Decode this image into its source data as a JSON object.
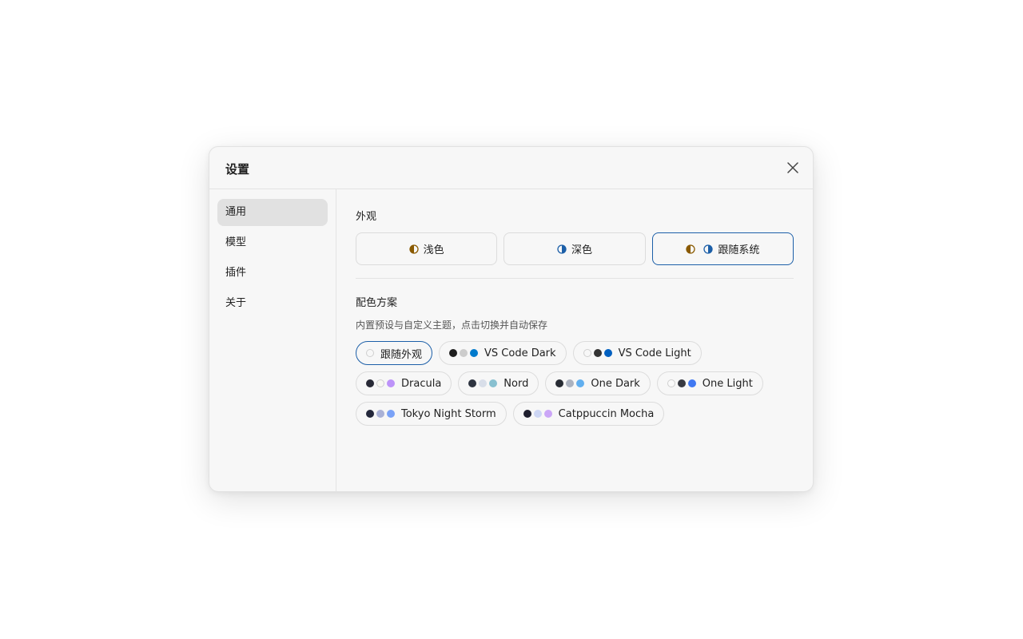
{
  "dialog": {
    "title": "设置",
    "close_icon": "close-icon"
  },
  "sidebar": {
    "items": [
      {
        "label": "通用",
        "active": true
      },
      {
        "label": "模型",
        "active": false
      },
      {
        "label": "插件",
        "active": false
      },
      {
        "label": "关于",
        "active": false
      }
    ]
  },
  "appearance": {
    "title": "外观",
    "options": [
      {
        "label": "浅色",
        "icon": "half-circle-icon",
        "selected": false
      },
      {
        "label": "深色",
        "icon": "half-circle-icon",
        "selected": false
      },
      {
        "label": "跟随系统",
        "icon": "half-circle-icon",
        "selected": true
      }
    ]
  },
  "color_scheme": {
    "title": "配色方案",
    "hint": "内置预设与自定义主题，点击切换并自动保存",
    "schemes": [
      {
        "label": "跟随外观",
        "selected": true,
        "colors": [
          "#f7f7f7"
        ]
      },
      {
        "label": "VS Code Dark",
        "selected": false,
        "colors": [
          "#1e1e1e",
          "#cccccc",
          "#007acc"
        ]
      },
      {
        "label": "VS Code Light",
        "selected": false,
        "colors": [
          "#f7f7f7",
          "#333333",
          "#0060c0"
        ]
      },
      {
        "label": "Dracula",
        "selected": false,
        "colors": [
          "#282a36",
          "#f8f8f2",
          "#bd93f9"
        ]
      },
      {
        "label": "Nord",
        "selected": false,
        "colors": [
          "#2e3440",
          "#d8dee9",
          "#88c0d0"
        ]
      },
      {
        "label": "One Dark",
        "selected": false,
        "colors": [
          "#282c34",
          "#abb2bf",
          "#61afef"
        ]
      },
      {
        "label": "One Light",
        "selected": false,
        "colors": [
          "#fafafa",
          "#383a42",
          "#4078f2"
        ]
      },
      {
        "label": "Tokyo Night Storm",
        "selected": false,
        "colors": [
          "#24283b",
          "#a9b1d6",
          "#7aa2f7"
        ]
      },
      {
        "label": "Catppuccin Mocha",
        "selected": false,
        "colors": [
          "#1e1e2e",
          "#cdd6f4",
          "#cba6f7"
        ]
      }
    ]
  },
  "colors": {
    "accent": "#1c5fa8",
    "light_icon": "#8a5a00",
    "dark_icon": "#1c5fa8"
  }
}
